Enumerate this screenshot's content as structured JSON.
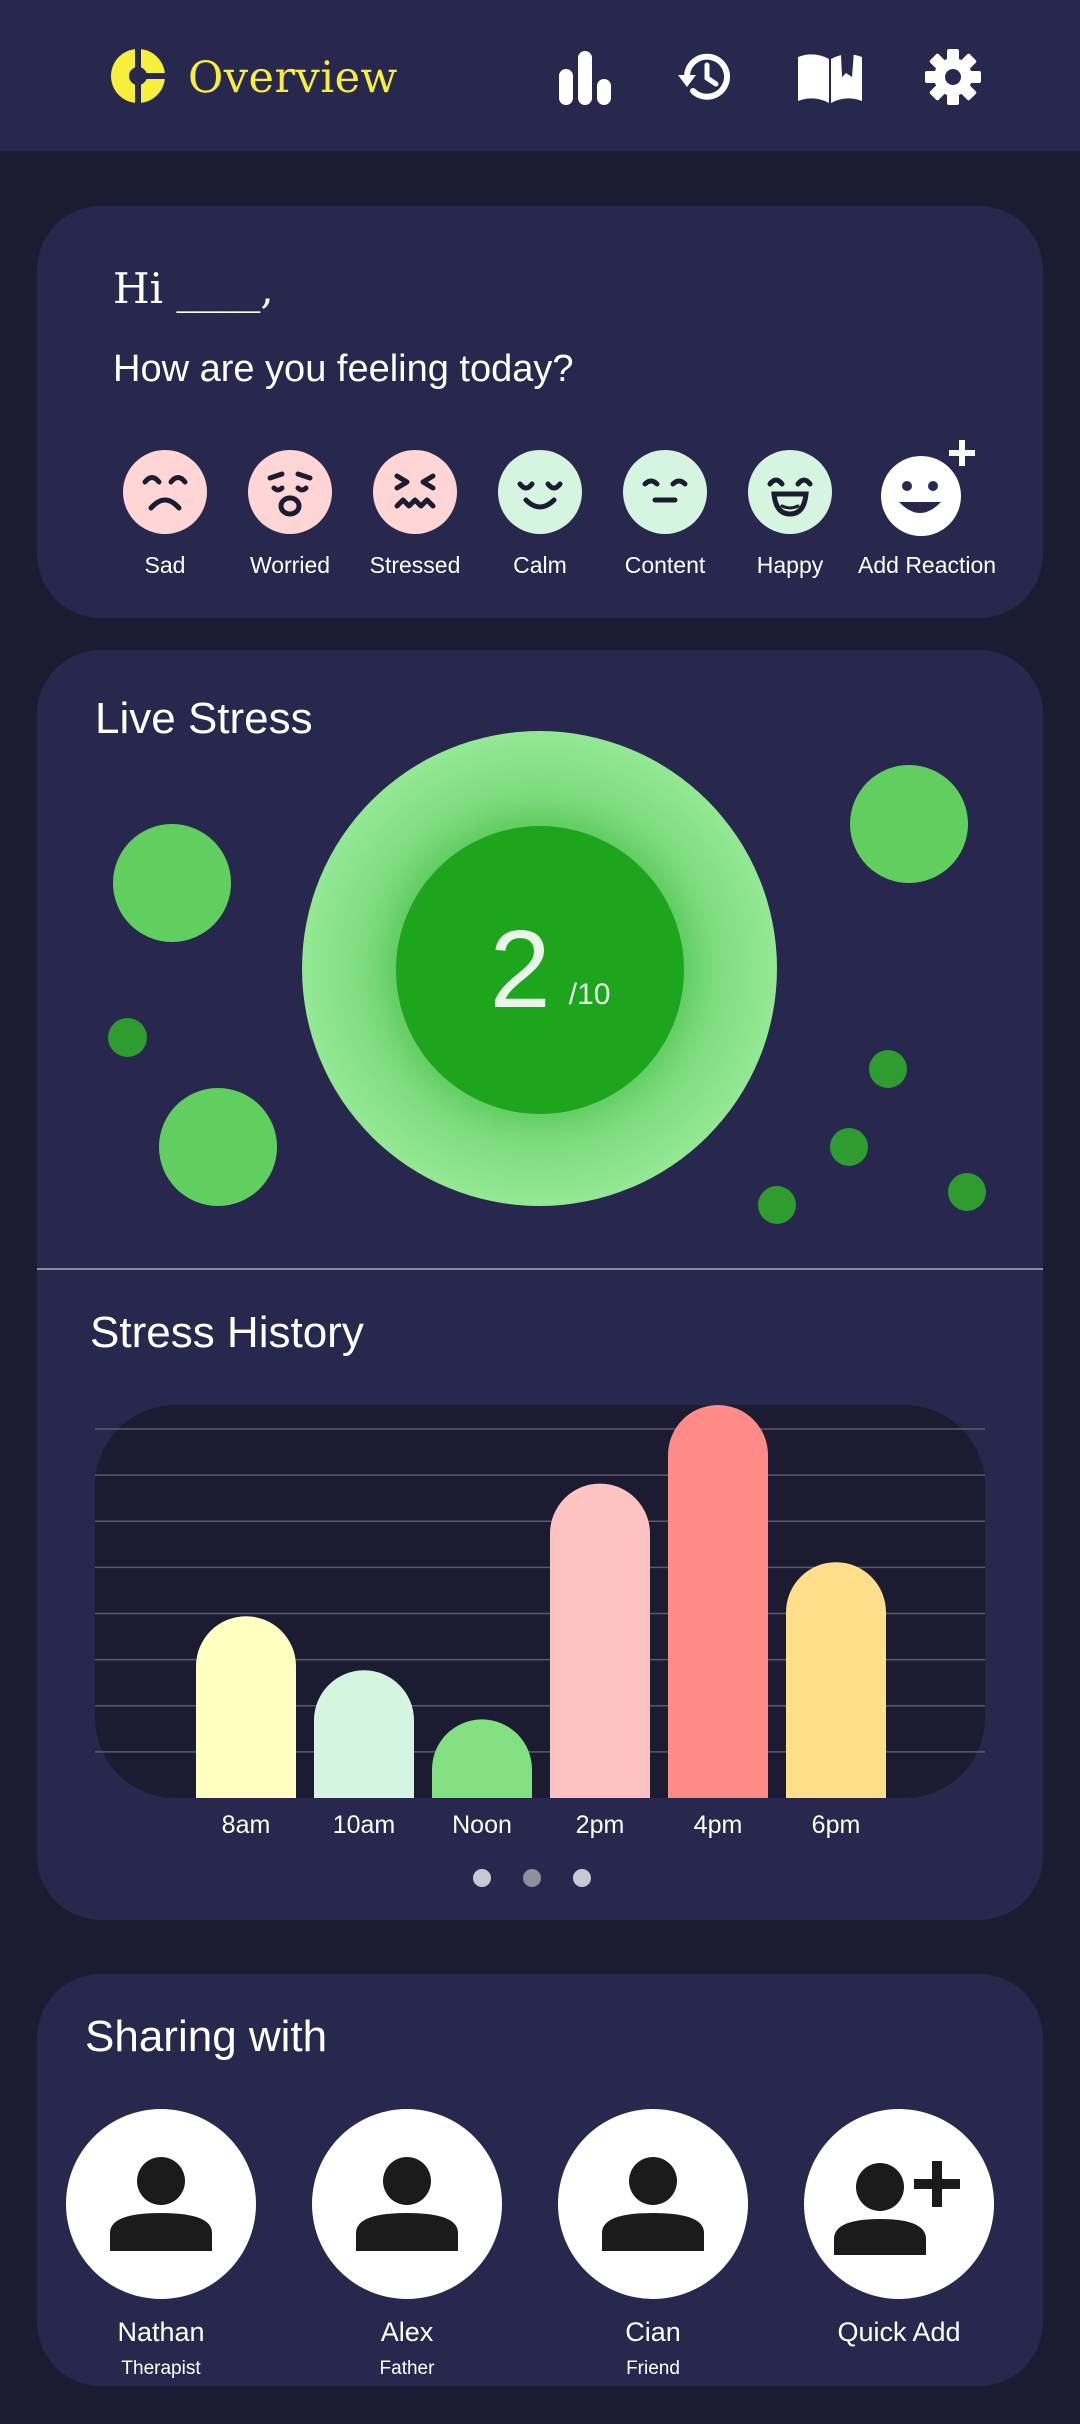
{
  "header": {
    "title": "Overview",
    "brand_color": "#f7ef3b",
    "icons": [
      "stats-bar-icon",
      "history-icon",
      "book-icon",
      "settings-gear-icon"
    ]
  },
  "mood": {
    "greeting": "Hi ____,",
    "question": "How are you feeling today?",
    "reactions": [
      {
        "label": "Sad",
        "icon": "sad-face-icon",
        "color": "#ffd5d5"
      },
      {
        "label": "Worried",
        "icon": "worried-face-icon",
        "color": "#ffd5d5"
      },
      {
        "label": "Stressed",
        "icon": "stressed-face-icon",
        "color": "#ffd5d5"
      },
      {
        "label": "Calm",
        "icon": "calm-face-icon",
        "color": "#d6f5e0"
      },
      {
        "label": "Content",
        "icon": "content-face-icon",
        "color": "#d6f5e0"
      },
      {
        "label": "Happy",
        "icon": "happy-face-icon",
        "color": "#d6f5e0"
      },
      {
        "label": "Add Reaction",
        "icon": "add-reaction-icon",
        "color": "#ffffff"
      }
    ]
  },
  "live_stress": {
    "title": "Live Stress",
    "value": "2",
    "scale": "/10"
  },
  "stress_history": {
    "title": "Stress History",
    "page_count": 3,
    "active_page": 1
  },
  "chart_data": {
    "type": "bar",
    "categories": [
      "8am",
      "10am",
      "Noon",
      "2pm",
      "4pm",
      "6pm"
    ],
    "values": [
      3.7,
      2.6,
      1.6,
      6.4,
      8.0,
      4.8
    ],
    "colors": [
      "#ffffc2",
      "#d6f5e0",
      "#82e082",
      "#ffc2c2",
      "#ff8a8a",
      "#ffdf8a"
    ],
    "ylim": [
      0,
      8
    ],
    "grid": true,
    "title": "",
    "xlabel": "",
    "ylabel": ""
  },
  "sharing": {
    "title": "Sharing with",
    "people": [
      {
        "name": "Nathan",
        "role": "Therapist",
        "icon": "person-icon"
      },
      {
        "name": "Alex",
        "role": "Father",
        "icon": "person-icon"
      },
      {
        "name": "Cian",
        "role": "Friend",
        "icon": "person-icon"
      },
      {
        "name": "Quick Add",
        "role": "",
        "icon": "add-person-icon"
      }
    ]
  }
}
